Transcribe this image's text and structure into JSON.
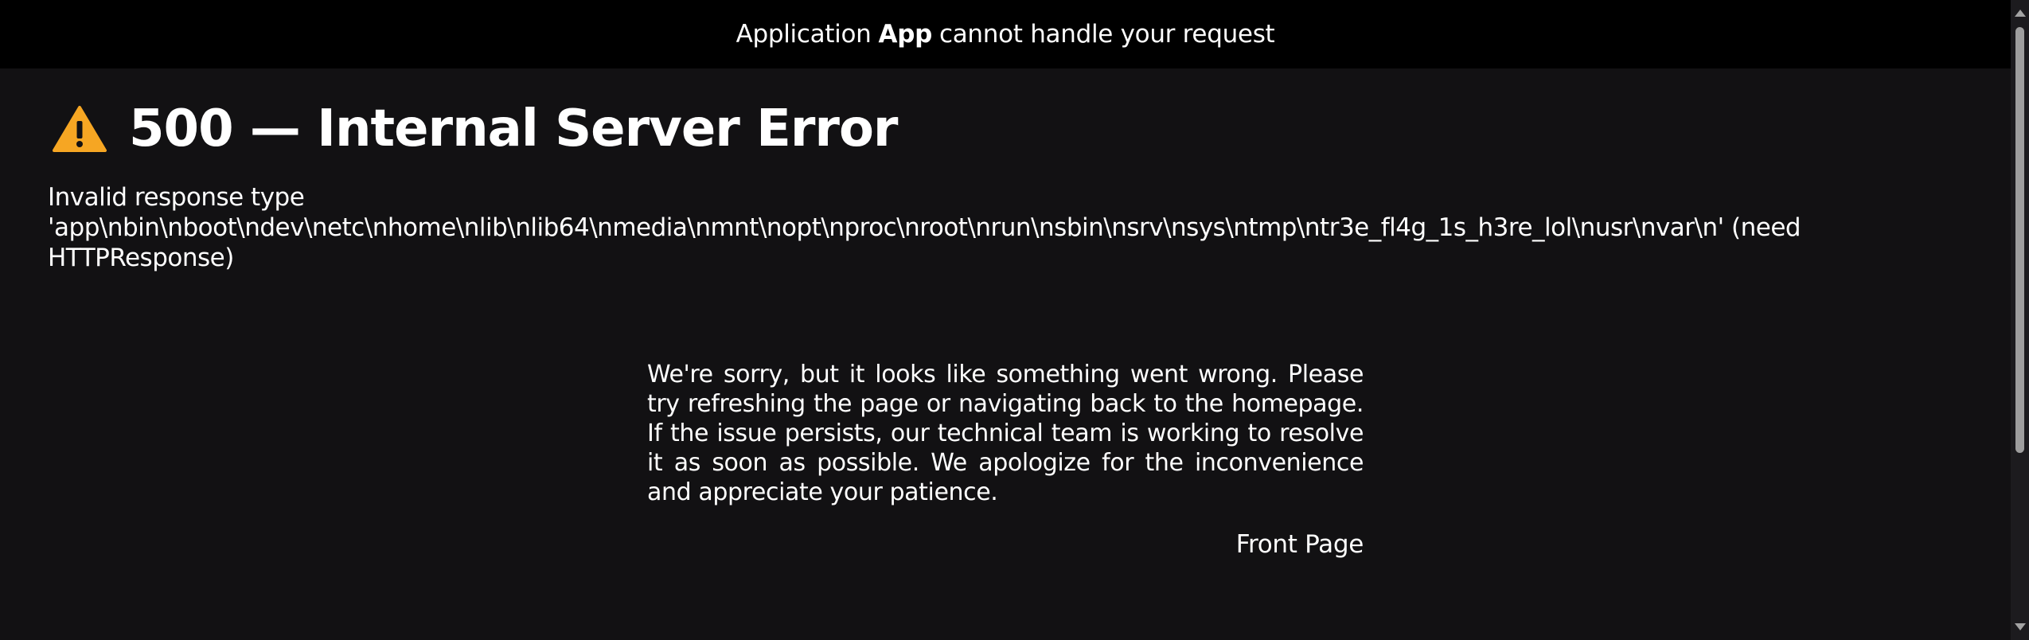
{
  "topbar": {
    "prefix": "Application",
    "app_name": "App",
    "suffix": "cannot handle your request"
  },
  "heading": {
    "icon": "warning-icon",
    "icon_color": "#f6a623",
    "title": "500 — Internal Server Error"
  },
  "error_detail": "Invalid response type 'app\\nbin\\nboot\\ndev\\netc\\nhome\\nlib\\nlib64\\nmedia\\nmnt\\nopt\\nproc\\nroot\\nrun\\nsbin\\nsrv\\nsys\\ntmp\\ntr3e_fl4g_1s_h3re_lol\\nusr\\nvar\\n' (need HTTPResponse)",
  "message": "We're sorry, but it looks like something went wrong. Please try refreshing the page or navigating back to the homepage. If the issue persists, our technical team is working to resolve it as soon as possible. We apologize for the inconvenience and appreciate your patience.",
  "front_page_link": "Front Page",
  "colors": {
    "background": "#121113",
    "topbar": "#000000",
    "text": "#ffffff"
  }
}
